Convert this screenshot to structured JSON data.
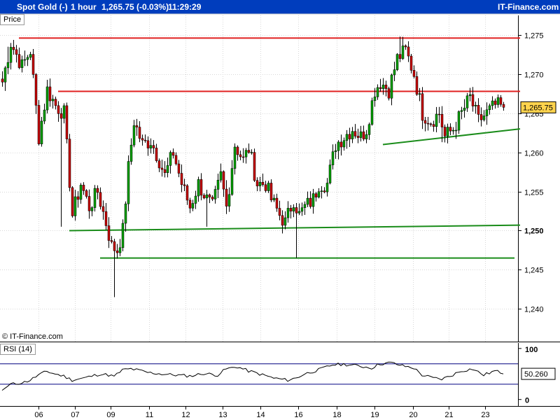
{
  "header": {
    "instrument": "Spot Gold (-)",
    "timeframe": "1 hour",
    "quote": "1,265.75 (-0.03%)",
    "time": "11:29:29",
    "brand": "IT-Finance.com"
  },
  "panels": {
    "price_tab": "Price",
    "rsi_tab": "RSI (14)",
    "copyright": "© IT-Finance.com"
  },
  "colors": {
    "header_bg": "#003dbd",
    "candle_up": "#00a000",
    "candle_down": "#c80000",
    "resistance": "#e02020",
    "support": "#1a8c1a",
    "rsi_line": "#000000",
    "rsi_band": "#000080",
    "last_price_bg": "#ffd34d"
  },
  "chart_data": [
    {
      "type": "candlestick",
      "title": "Spot Gold (-)",
      "timeframe": "1 hour",
      "x_ticks": [
        "06",
        "07",
        "09",
        "11",
        "12",
        "13",
        "14",
        "16",
        "18",
        "19",
        "20",
        "21",
        "23"
      ],
      "y_ticks": [
        {
          "value": 1240,
          "label": "1,240"
        },
        {
          "value": 1245,
          "label": "1,245"
        },
        {
          "value": 1250,
          "label": "1,250",
          "bold": true
        },
        {
          "value": 1255,
          "label": "1,255"
        },
        {
          "value": 1260,
          "label": "1,260"
        },
        {
          "value": 1265,
          "label": "1,265"
        },
        {
          "value": 1270,
          "label": "1,270"
        },
        {
          "value": 1275,
          "label": "1,275"
        }
      ],
      "ylim": [
        1236.0,
        1277.5
      ],
      "last_price": {
        "value": 1265.75,
        "label": "1,265.75"
      },
      "path": [
        [
          0,
          1269
        ],
        [
          3,
          1274
        ],
        [
          7,
          1271
        ],
        [
          10,
          1273
        ],
        [
          13,
          1262
        ],
        [
          16,
          1268
        ],
        [
          19,
          1266
        ],
        [
          22,
          1265
        ],
        [
          25,
          1252
        ],
        [
          28,
          1256
        ],
        [
          31,
          1253
        ],
        [
          34,
          1255
        ],
        [
          37,
          1251
        ],
        [
          39,
          1248
        ],
        [
          41,
          1247.5
        ],
        [
          43,
          1250
        ],
        [
          45,
          1258
        ],
        [
          47,
          1264
        ],
        [
          50,
          1261
        ],
        [
          53,
          1261.5
        ],
        [
          56,
          1259
        ],
        [
          58,
          1257
        ],
        [
          61,
          1260
        ],
        [
          64,
          1256
        ],
        [
          67,
          1253
        ],
        [
          70,
          1256
        ],
        [
          73,
          1254
        ],
        [
          75,
          1253
        ],
        [
          78,
          1257
        ],
        [
          80,
          1253
        ],
        [
          83,
          1261
        ],
        [
          86,
          1259
        ],
        [
          88,
          1260.5
        ],
        [
          91,
          1256
        ],
        [
          94,
          1256
        ],
        [
          96,
          1254
        ],
        [
          99,
          1252
        ],
        [
          101,
          1251
        ],
        [
          104,
          1254
        ],
        [
          106,
          1252
        ],
        [
          108,
          1253
        ],
        [
          111,
          1254
        ],
        [
          113,
          1256
        ],
        [
          116,
          1256
        ],
        [
          119,
          1261
        ],
        [
          122,
          1262
        ],
        [
          125,
          1263
        ],
        [
          128,
          1262
        ],
        [
          130,
          1263
        ],
        [
          133,
          1268
        ],
        [
          135,
          1269
        ],
        [
          138,
          1268
        ],
        [
          141,
          1272
        ],
        [
          144,
          1273
        ],
        [
          147,
          1270
        ],
        [
          150,
          1265
        ],
        [
          153,
          1264
        ],
        [
          156,
          1265
        ],
        [
          158,
          1262
        ],
        [
          161,
          1263
        ],
        [
          164,
          1265
        ],
        [
          167,
          1267
        ],
        [
          170,
          1264
        ],
        [
          173,
          1265
        ],
        [
          176,
          1266
        ],
        [
          179,
          1265.75
        ]
      ],
      "spikes": [
        {
          "index": 2,
          "high": 1273.5
        },
        {
          "index": 21,
          "low": 1250.5
        },
        {
          "index": 40,
          "low": 1241.5
        },
        {
          "index": 73,
          "low": 1250.5
        },
        {
          "index": 105,
          "low": 1246.5
        },
        {
          "index": 142,
          "high": 1274.8
        },
        {
          "index": 157,
          "low": 1261.3
        }
      ],
      "trendlines": [
        {
          "role": "resistance",
          "from": {
            "x": 6,
            "y": 1274.6
          },
          "to": {
            "x": 185,
            "y": 1274.6
          }
        },
        {
          "role": "resistance",
          "from": {
            "x": 20,
            "y": 1267.8
          },
          "to": {
            "x": 185,
            "y": 1267.8
          }
        },
        {
          "role": "support",
          "from": {
            "x": 24,
            "y": 1250.0
          },
          "to": {
            "x": 185,
            "y": 1250.7
          }
        },
        {
          "role": "support",
          "from": {
            "x": 35,
            "y": 1246.5
          },
          "to": {
            "x": 183,
            "y": 1246.5
          }
        },
        {
          "role": "support",
          "from": {
            "x": 136,
            "y": 1261.0
          },
          "to": {
            "x": 185,
            "y": 1263.0
          }
        }
      ]
    },
    {
      "type": "line",
      "title": "RSI (14)",
      "y_ticks": [
        {
          "value": 0,
          "label": "0"
        },
        {
          "value": 100,
          "label": "100"
        }
      ],
      "ylim": [
        -10,
        108
      ],
      "bands": [
        30,
        70
      ],
      "last_value": {
        "value": 50.26,
        "label": "50.260"
      },
      "path": [
        [
          0,
          18
        ],
        [
          3,
          30
        ],
        [
          5,
          31
        ],
        [
          8,
          34
        ],
        [
          10,
          38
        ],
        [
          13,
          48
        ],
        [
          16,
          55
        ],
        [
          19,
          50
        ],
        [
          22,
          46
        ],
        [
          25,
          38
        ],
        [
          30,
          43
        ],
        [
          35,
          50
        ],
        [
          38,
          48
        ],
        [
          40,
          45
        ],
        [
          43,
          58
        ],
        [
          46,
          60
        ],
        [
          49,
          57
        ],
        [
          52,
          53
        ],
        [
          57,
          50
        ],
        [
          62,
          48
        ],
        [
          67,
          46
        ],
        [
          72,
          51
        ],
        [
          77,
          48
        ],
        [
          80,
          60
        ],
        [
          84,
          64
        ],
        [
          88,
          56
        ],
        [
          92,
          50
        ],
        [
          97,
          42
        ],
        [
          102,
          38
        ],
        [
          105,
          42
        ],
        [
          108,
          50
        ],
        [
          113,
          58
        ],
        [
          118,
          68
        ],
        [
          122,
          69
        ],
        [
          127,
          66
        ],
        [
          132,
          62
        ],
        [
          135,
          70
        ],
        [
          139,
          72
        ],
        [
          143,
          66
        ],
        [
          147,
          62
        ],
        [
          150,
          48
        ],
        [
          154,
          42
        ],
        [
          157,
          40
        ],
        [
          160,
          46
        ],
        [
          164,
          56
        ],
        [
          168,
          60
        ],
        [
          172,
          48
        ],
        [
          176,
          56
        ],
        [
          179,
          52
        ]
      ]
    }
  ]
}
